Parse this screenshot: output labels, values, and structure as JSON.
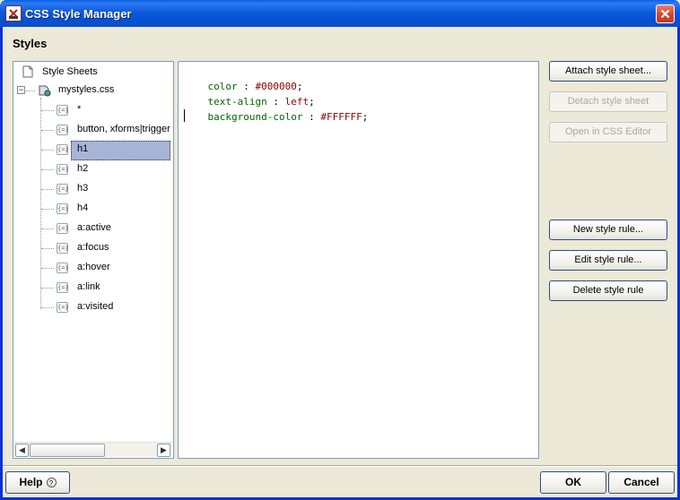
{
  "window": {
    "title": "CSS Style Manager",
    "title_icon": "css-manager-icon",
    "close_icon": "close-icon"
  },
  "heading": "Styles",
  "tree": {
    "root_label": "Style Sheets",
    "stylesheet": "mystyles.css",
    "rules": [
      "*",
      "button, xforms|trigger",
      "h1",
      "h2",
      "h3",
      "h4",
      "a:active",
      "a:focus",
      "a:hover",
      "a:link",
      "a:visited"
    ],
    "selected_rule": "h1",
    "rule_icon_text": "{=}"
  },
  "editor": {
    "lines": [
      {
        "prop": "color",
        "sep": " : ",
        "val": "#000000",
        "end": ";"
      },
      {
        "prop": "text-align",
        "sep": " : ",
        "val": "left",
        "end": ";"
      },
      {
        "prop": "background-color",
        "sep": " : ",
        "val": "#FFFFFF",
        "end": ";"
      }
    ]
  },
  "buttons": {
    "attach": "Attach style sheet...",
    "detach": "Detach style sheet",
    "open_editor": "Open in CSS Editor",
    "new_rule": "New style rule...",
    "edit_rule": "Edit style rule...",
    "delete_rule": "Delete style rule",
    "help": "Help",
    "help_icon": "?",
    "ok": "OK",
    "cancel": "Cancel"
  },
  "colors": {
    "titlebar": "#0A5FE0",
    "selection": "#A6B4D6",
    "css_property": "#006400",
    "css_value": "#8B0000"
  }
}
